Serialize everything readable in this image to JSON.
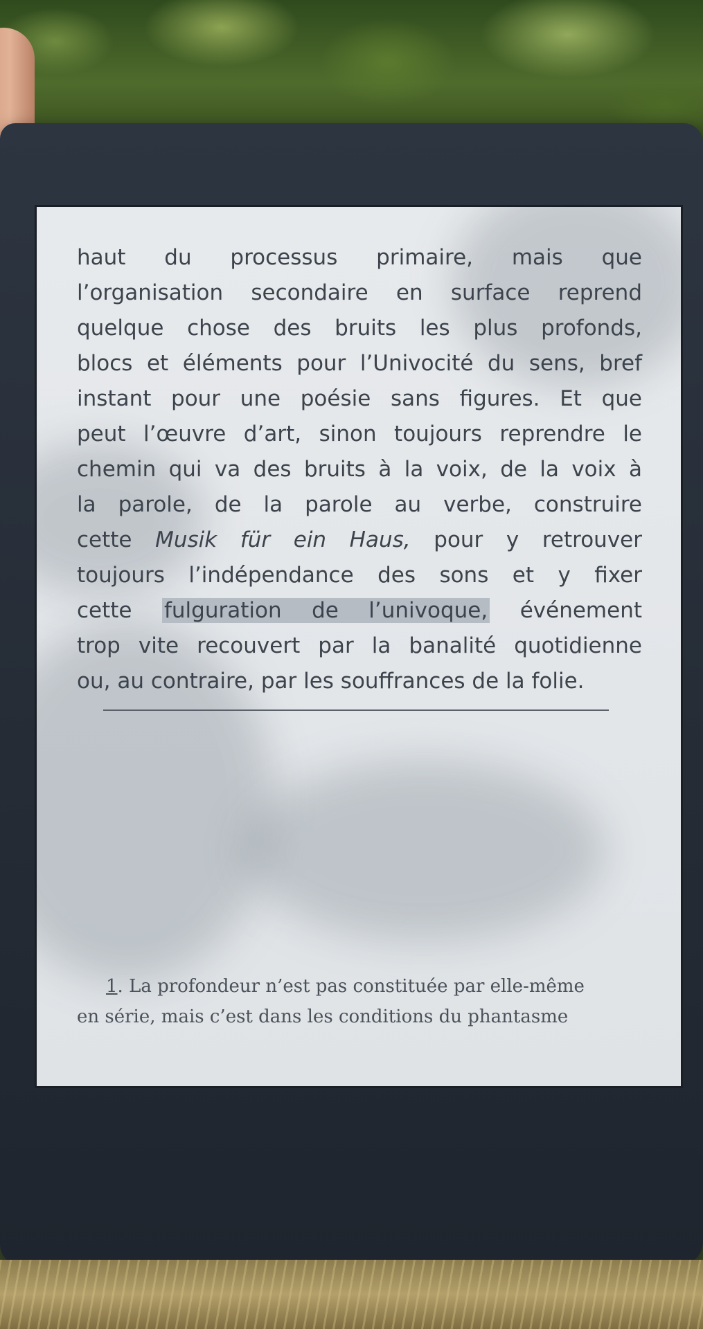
{
  "book_page": {
    "lines": [
      "haut du processus primaire, mais que",
      "l’organisation secondaire en surface reprend",
      "quelque chose des bruits les plus profonds,",
      "blocs et éléments pour l’Univocité du sens, bref",
      "instant pour une poésie sans figures. Et que",
      "peut l’œuvre d’art, sinon toujours reprendre le",
      "chemin qui va des bruits à la voix, de la voix à",
      "la parole, de la parole au verbe, construire"
    ],
    "line9": {
      "before": "cette ",
      "italic": "Musik für ein Haus,",
      "after": " pour y retrouver"
    },
    "line10": "toujours l’indépendance des sons et y fixer",
    "line11": {
      "before": "cette ",
      "highlighted": "fulguration de l’univoque,",
      "after": " événement"
    },
    "line12": "trop vite recouvert par la banalité quotidienne",
    "line13": "ou, au contraire, par les souffrances de la folie.",
    "footnote": {
      "number": "1",
      "line1": ". La profondeur n’est pas constituée par elle-même",
      "line2": "en série, mais c’est dans les conditions du phantasme"
    }
  }
}
